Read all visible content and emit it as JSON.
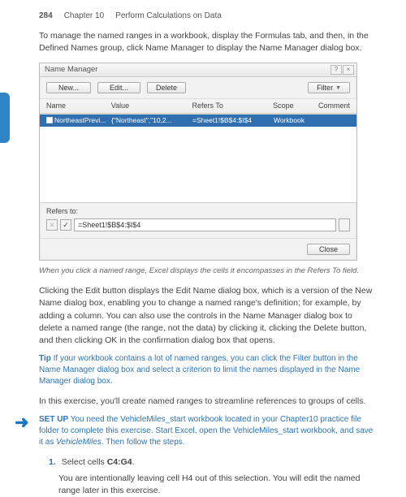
{
  "header": {
    "page_num": "284",
    "chapter": "Chapter 10",
    "chapter_title": "Perform Calculations on Data"
  },
  "body": {
    "p1": "To manage the named ranges in a workbook, display the Formulas tab, and then, in the Defined Names group, click Name Manager to display the Name Manager dialog box.",
    "caption": "When you click a named range, Excel displays the cells it encompasses in the Refers To field.",
    "p2": " Clicking the Edit button displays the Edit Name dialog box, which is a version of the New Name dialog box, enabling you to change a named range's definition; for example, by adding a column. You can also use the controls in the Name Manager dialog box to delete a named range (the range, not the data) by clicking it, clicking the Delete button, and then clicking OK in the confirmation dialog box that opens.",
    "tip_label": "Tip",
    "tip_text": "If your workbook contains a lot of named ranges, you can click the Filter button in the Name Manager dialog box and select a criterion to limit the names displayed in the Name Manager dialog box.",
    "p3": "In this exercise, you'll create named ranges to streamline references to groups of cells.",
    "setup_label": "SET UP",
    "setup_text": "You need the VehicleMiles_start workbook located in your Chapter10 practice file folder to complete this exercise. Start Excel, open the VehicleMiles_start workbook, and save it as ",
    "setup_filename": "VehicleMiles",
    "setup_tail": ". Then follow the steps.",
    "step1_num": "1.",
    "step1_a": "Select cells ",
    "step1_bold": "C4:G4",
    "step1_c": ".",
    "step1_sub": "You are intentionally leaving cell H4 out of this selection. You will edit the named range later in this exercise."
  },
  "dialog": {
    "title": "Name Manager",
    "btn_new": "New...",
    "btn_edit": "Edit...",
    "btn_delete": "Delete",
    "btn_filter": "Filter",
    "btn_close": "Close",
    "cols": {
      "name": "Name",
      "value": "Value",
      "refers": "Refers To",
      "scope": "Scope",
      "comment": "Comment"
    },
    "row": {
      "name": "NortheastPrevi...",
      "value": "{\"Northeast\",\"10,2...",
      "refers": "=Sheet1!$B$4:$I$4",
      "scope": "Workbook"
    },
    "refersto_label": "Refers to:",
    "refersto_value": "=Sheet1!$B$4:$I$4"
  }
}
